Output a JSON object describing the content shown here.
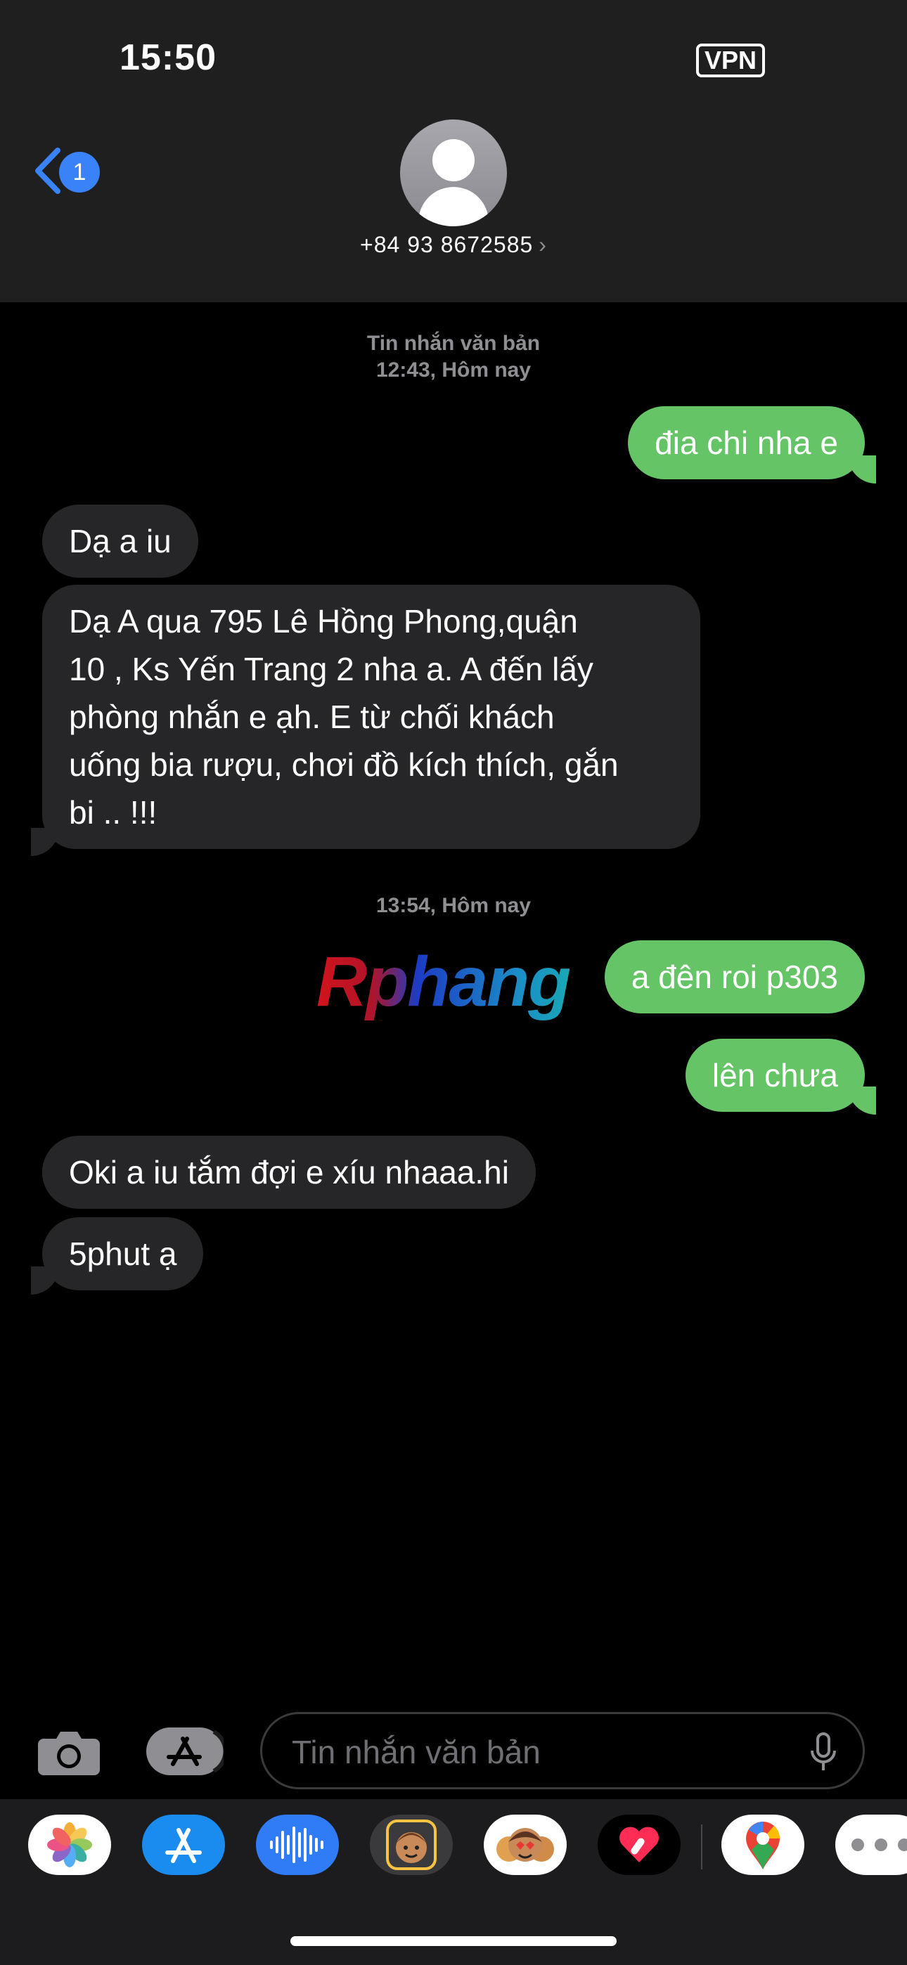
{
  "status_bar": {
    "time": "15:50",
    "vpn": "VPN"
  },
  "header": {
    "back_badge_count": "1",
    "contact_number": "+84 93 8672585",
    "contact_chevron": "›"
  },
  "timestamps": [
    {
      "line1": "Tin nhắn văn bản",
      "line2": "12:43, Hôm nay"
    },
    {
      "line1": "13:54, Hôm nay"
    }
  ],
  "messages": [
    {
      "direction": "out",
      "text": "đia chi nha e"
    },
    {
      "direction": "in",
      "text": "Dạ a iu"
    },
    {
      "direction": "in",
      "lines": [
        "Dạ A qua 795 Lê Hồng Phong,quận",
        "10 , Ks Yến Trang 2 nha a. A đến lấy",
        "phòng nhắn e ạh. E từ chối khách",
        "uống bia rượu, chơi đồ kích thích, gắn",
        "bi .. !!!"
      ]
    },
    {
      "direction": "out",
      "text": "a đên roi p303"
    },
    {
      "direction": "out",
      "text": "lên chưa"
    },
    {
      "direction": "in",
      "text": "Oki a iu tắm đợi e xíu nhaaa.hi"
    },
    {
      "direction": "in",
      "text": "5phut ạ"
    }
  ],
  "watermark": "Rphang",
  "composer": {
    "placeholder": "Tin nhắn văn bản"
  },
  "app_drawer": {
    "apps": [
      "photos-icon",
      "app-store-icon",
      "audio-message-icon",
      "memoji-icon",
      "animoji-icon",
      "digital-touch-icon",
      "google-maps-icon",
      "more-apps-icon"
    ]
  },
  "colors": {
    "outgoing_bubble": "#65c466",
    "incoming_bubble": "#262628",
    "accent": "#3a82f7"
  }
}
